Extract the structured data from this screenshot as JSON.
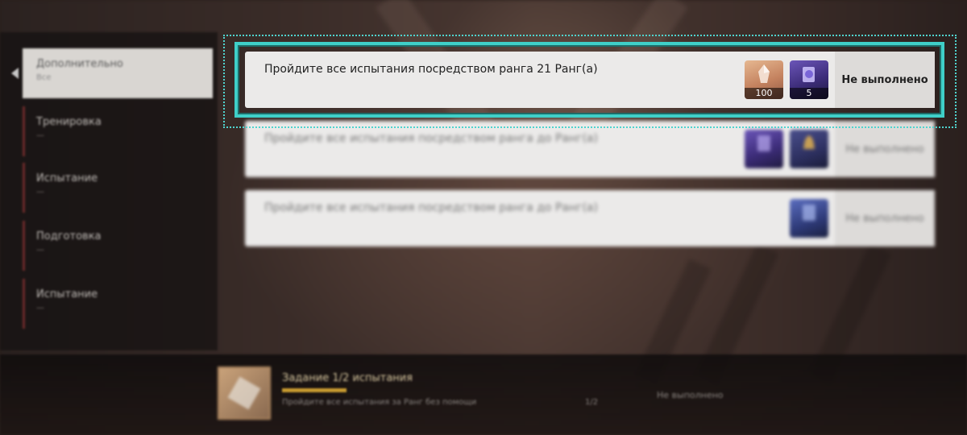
{
  "sidebar": {
    "items": [
      {
        "title": "Дополнительно",
        "subtitle": "Все"
      },
      {
        "title": "Тренировка",
        "subtitle": "—"
      },
      {
        "title": "Испытание",
        "subtitle": "—"
      },
      {
        "title": "Подготовка",
        "subtitle": "—"
      },
      {
        "title": "Испытание",
        "subtitle": "—"
      }
    ]
  },
  "challenges": [
    {
      "description": "Пройдите все испытания посредством ранга 21 Ранг(а)",
      "rewards": [
        {
          "icon": "crystal-icon",
          "qty": "100",
          "color": "#d49a74"
        },
        {
          "icon": "tome-icon",
          "qty": "5",
          "color": "#5a48a8"
        }
      ],
      "status": "Не выполнено"
    },
    {
      "description": "Пройдите все испытания посредством ранга до Ранг(а)",
      "rewards": [
        {
          "icon": "tome-icon",
          "qty": "",
          "color": "#4a3f80"
        },
        {
          "icon": "bell-icon",
          "qty": "",
          "color": "#3b4280"
        }
      ],
      "status": "Не выполнено"
    },
    {
      "description": "Пройдите все испытания посредством ранга до Ранг(а)",
      "rewards": [
        {
          "icon": "tome-icon",
          "qty": "",
          "color": "#3b4a90"
        }
      ],
      "status": "Не выполнено"
    }
  ],
  "bottom": {
    "title": "Задание 1/2 испытания",
    "description": "Пройдите все испытания за Ранг без помощи",
    "count": "1/2",
    "status": "Не выполнено",
    "progress": 0.5
  }
}
